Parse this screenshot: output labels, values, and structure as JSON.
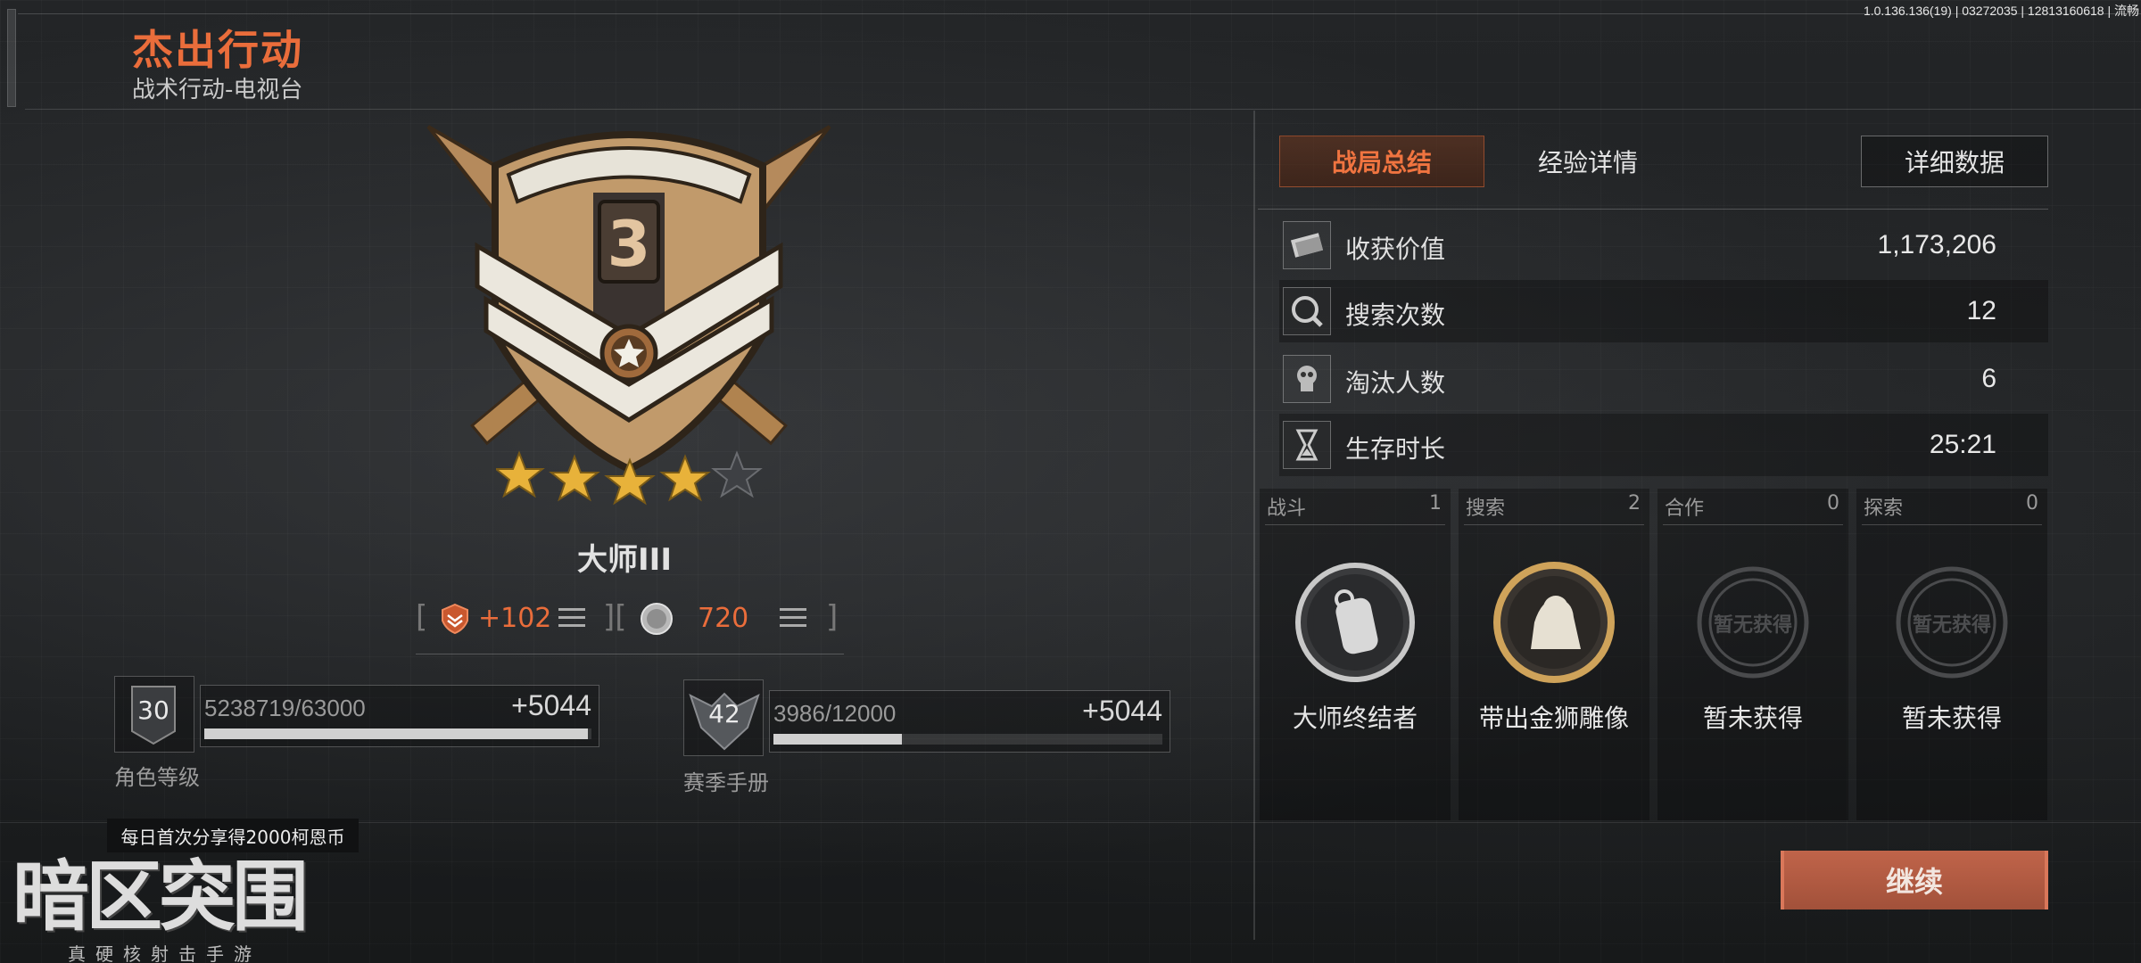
{
  "version": "1.0.136.136(19) | 03272035 | 12813160618 | 流畅",
  "header": {
    "title": "杰出行动",
    "subtitle": "战术行动-电视台"
  },
  "rank": {
    "badge_number": "3",
    "stars_earned": 4,
    "stars_total": 5,
    "name": "大师III",
    "points_gain": "+102",
    "coin_value": "720"
  },
  "role_level": {
    "level": "30",
    "progress_text": "5238719/63000",
    "gain": "+5044",
    "progress": 0.99,
    "label": "角色等级"
  },
  "season_manual": {
    "level": "42",
    "progress_text": "3986/12000",
    "gain": "+5044",
    "progress": 0.33,
    "label": "赛季手册"
  },
  "share_tip": "每日首次分享得2000柯恩币",
  "logo": {
    "main": "暗区突围",
    "sub": "真硬核射击手游"
  },
  "tabs": {
    "summary": "战局总结",
    "exp": "经验详情",
    "detail": "详细数据"
  },
  "stats": [
    {
      "label": "收获价值",
      "value": "1,173,206",
      "icon": "money-icon"
    },
    {
      "label": "搜索次数",
      "value": "12",
      "icon": "search-icon"
    },
    {
      "label": "淘汰人数",
      "value": "6",
      "icon": "skull-icon"
    },
    {
      "label": "生存时长",
      "value": "25:21",
      "icon": "hourglass-icon"
    }
  ],
  "medals": [
    {
      "category": "战斗",
      "count": "1",
      "name": "大师终结者",
      "icon": "dogtag-medal-icon"
    },
    {
      "category": "搜索",
      "count": "2",
      "name": "带出金狮雕像",
      "icon": "gold-lion-medal-icon"
    },
    {
      "category": "合作",
      "count": "0",
      "name": "暂未获得",
      "icon": "locked-medal-icon"
    },
    {
      "category": "探索",
      "count": "0",
      "name": "暂未获得",
      "icon": "locked-medal-icon"
    }
  ],
  "locked_stamp": "暂无获得",
  "continue_label": "继续",
  "colors": {
    "accent": "#ea6d3b",
    "button": "#b35a41"
  }
}
